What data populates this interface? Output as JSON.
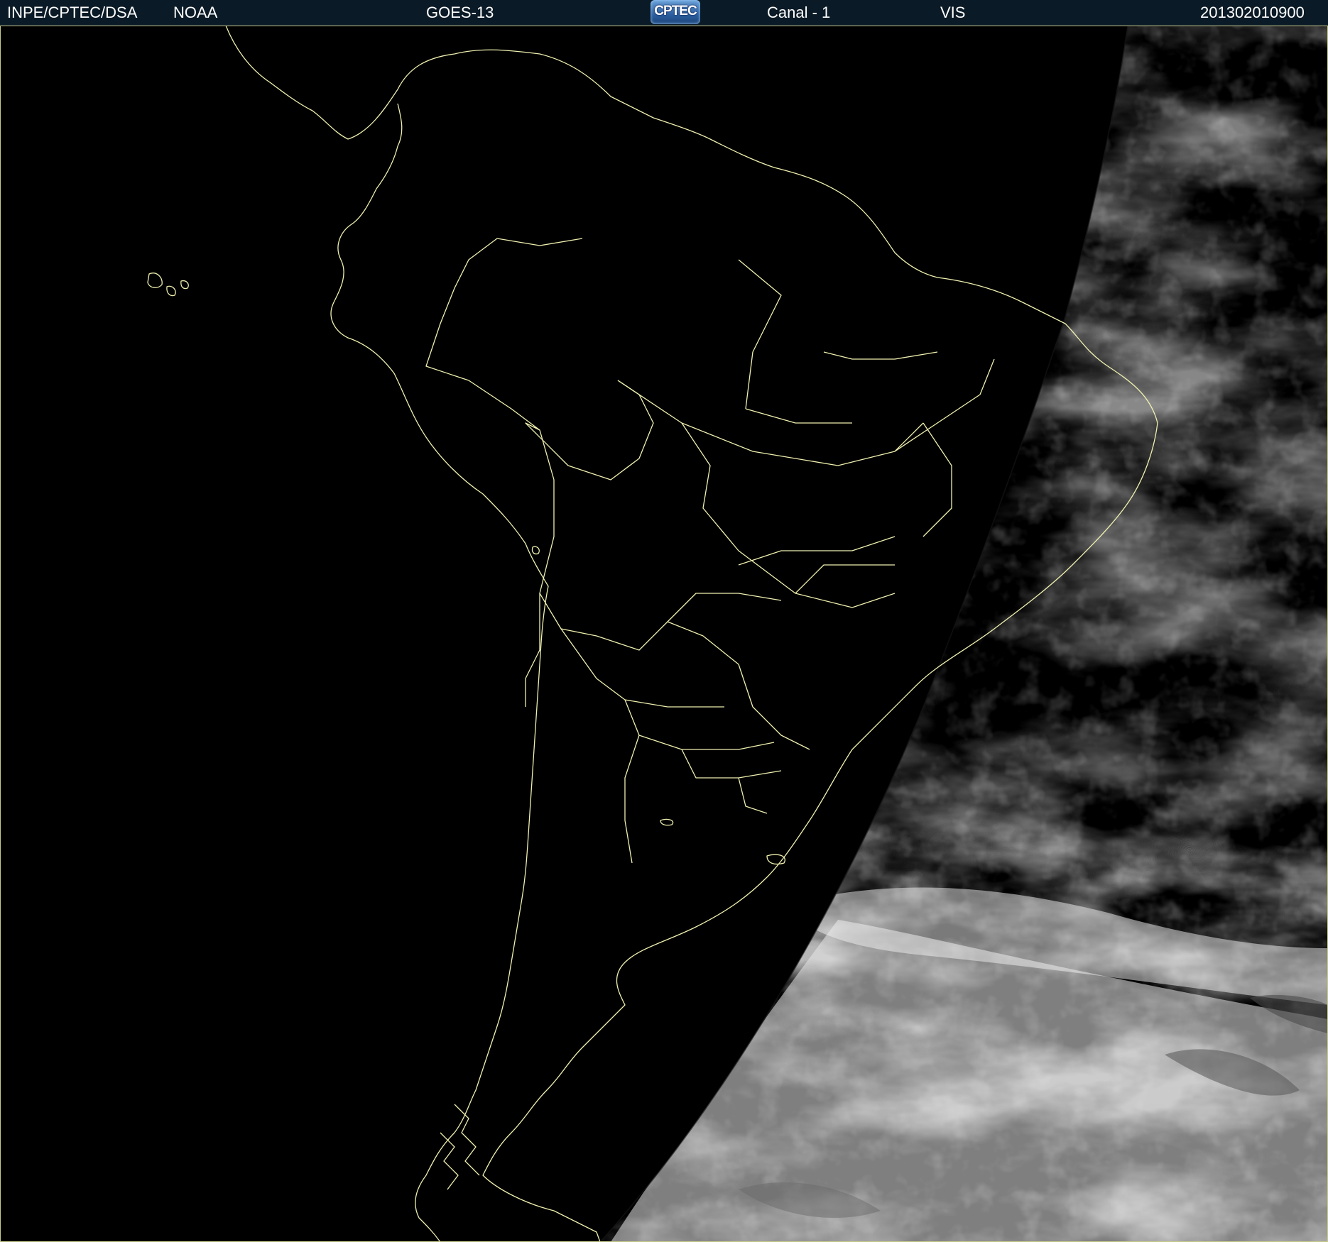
{
  "header": {
    "organization": "INPE/CPTEC/DSA",
    "agency": "NOAA",
    "satellite": "GOES-13",
    "logo_text": "CPTEC",
    "channel": "Canal - 1",
    "band": "VIS",
    "timestamp": "201302010900"
  },
  "colors": {
    "header_bg": "#0a1a26",
    "boundary_line": "#f0f0b0",
    "night_side": "#000000",
    "cloud_bright": "#ececec",
    "cloud_mid": "#8c8c8c",
    "ocean_dark": "#4a4a4a"
  },
  "icons": {
    "logo": "cptec-logo"
  }
}
